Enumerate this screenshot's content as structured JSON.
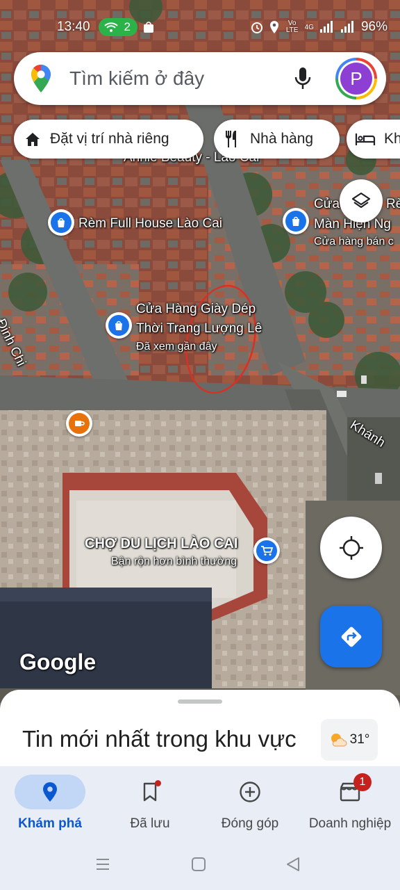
{
  "status_bar": {
    "time": "13:40",
    "hotspot_count": "2",
    "network_label": "Vo LTE",
    "network_type": "4G",
    "battery": "96%"
  },
  "search": {
    "placeholder": "Tìm kiếm ở đây",
    "avatar_letter": "P"
  },
  "chips": [
    {
      "label": "Đặt vị trí nhà riêng",
      "icon": "home-icon"
    },
    {
      "label": "Nhà hàng",
      "icon": "restaurant-icon"
    },
    {
      "label": "Kh",
      "icon": "hotel-icon"
    }
  ],
  "map": {
    "labels": {
      "annie": "Annie Beauty - Lào Cai",
      "rem": "Rèm Full House Lào Cai",
      "cua_top_1": "Cửa",
      "cua_top_2": "Rè",
      "man_hien": "Màn Hiện Ng",
      "cua_hang_ban": "Cửa hàng bán c",
      "giay_dep_1": "Cửa Hàng Giày Dép",
      "giay_dep_2": "Thời Trang Lượng Lê",
      "giay_dep_sub": "Đã xem gần đây",
      "dinh_chi": "Đinh Chi",
      "khanh": "Khánh",
      "cho": "CHỢ DU LỊCH LÀO CAI",
      "cho_sub": "Bận rộn hơn bình thường",
      "google": "Google"
    }
  },
  "sheet": {
    "title": "Tin mới nhất trong khu vực",
    "temperature": "31°"
  },
  "nav": [
    {
      "label": "Khám phá",
      "icon": "explore-pin-icon",
      "active": true
    },
    {
      "label": "Đã lưu",
      "icon": "bookmark-icon"
    },
    {
      "label": "Đóng góp",
      "icon": "add-circle-icon"
    },
    {
      "label": "Doanh nghiệp",
      "icon": "business-icon",
      "badge": "1"
    }
  ],
  "colors": {
    "accent": "#1a73e8",
    "shopping_pin": "#1a73e8",
    "cafe_pin": "#e8710a",
    "annotation_circle": "#d93025"
  }
}
